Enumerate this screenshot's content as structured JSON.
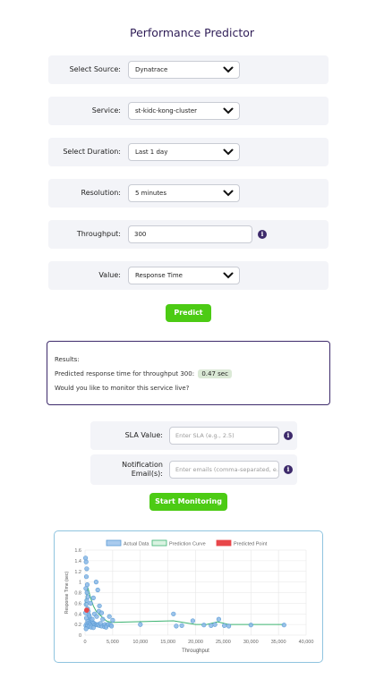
{
  "page": {
    "title": "Performance Predictor"
  },
  "form": {
    "source": {
      "label": "Select Source:",
      "value": "Dynatrace"
    },
    "service": {
      "label": "Service:",
      "value": "st-kidc-kong-cluster"
    },
    "duration": {
      "label": "Select Duration:",
      "value": "Last 1 day"
    },
    "resolution": {
      "label": "Resolution:",
      "value": "5 minutes"
    },
    "throughput": {
      "label": "Throughput:",
      "value": "300"
    },
    "value": {
      "label": "Value:",
      "value": "Response Time"
    },
    "predict_label": "Predict"
  },
  "results": {
    "heading": "Results:",
    "prediction_text": "Predicted response time for throughput 300:",
    "prediction_value": "0.47 sec",
    "question": "Would you like to monitor this service live?"
  },
  "monitoring": {
    "sla_label": "SLA Value:",
    "sla_placeholder": "Enter SLA (e.g., 2.5)",
    "email_label_1": "Notification",
    "email_label_2": "Email(s):",
    "email_placeholder": "Enter emails (comma-separated, e.g.",
    "start_label": "Start Monitoring"
  },
  "colors": {
    "accent_green": "#4ccb14",
    "brand_purple": "#3d2a6b",
    "actual_data": "#5b9bd5",
    "prediction_curve": "#3cb371",
    "predicted_point": "#e8474a"
  },
  "chart_data": {
    "type": "scatter",
    "xlabel": "Throughput",
    "ylabel": "Response Time (sec)",
    "xlim": [
      0,
      40000
    ],
    "ylim": [
      0,
      1.6
    ],
    "x_ticks": [
      "0",
      "5,000",
      "10,000",
      "15,000",
      "20,000",
      "25,000",
      "30,000",
      "35,000",
      "40,000"
    ],
    "y_ticks": [
      "0",
      "0.2",
      "0.4",
      "0.6",
      "0.8",
      "1",
      "1.2",
      "1.4",
      "1.6"
    ],
    "grid": true,
    "legend_position": "top",
    "legend": [
      "Actual Data",
      "Prediction Curve",
      "Predicted Point"
    ],
    "series": [
      {
        "name": "Actual Data",
        "points": [
          [
            100,
            1.45
          ],
          [
            200,
            1.38
          ],
          [
            300,
            1.25
          ],
          [
            250,
            1.1
          ],
          [
            400,
            0.95
          ],
          [
            150,
            0.88
          ],
          [
            350,
            0.8
          ],
          [
            500,
            0.72
          ],
          [
            300,
            0.65
          ],
          [
            200,
            0.58
          ],
          [
            450,
            0.5
          ],
          [
            600,
            0.45
          ],
          [
            100,
            0.42
          ],
          [
            700,
            0.38
          ],
          [
            800,
            0.35
          ],
          [
            250,
            0.32
          ],
          [
            900,
            0.3
          ],
          [
            1000,
            0.28
          ],
          [
            500,
            0.26
          ],
          [
            1200,
            0.25
          ],
          [
            1400,
            0.24
          ],
          [
            600,
            0.22
          ],
          [
            1600,
            0.22
          ],
          [
            300,
            0.21
          ],
          [
            1800,
            0.2
          ],
          [
            2000,
            0.2
          ],
          [
            800,
            0.19
          ],
          [
            2200,
            0.19
          ],
          [
            2400,
            0.2
          ],
          [
            2600,
            0.18
          ],
          [
            150,
            0.18
          ],
          [
            400,
            0.17
          ],
          [
            700,
            0.16
          ],
          [
            1100,
            0.15
          ],
          [
            1500,
            0.14
          ],
          [
            200,
            0.12
          ],
          [
            3000,
            0.17
          ],
          [
            3500,
            0.16
          ],
          [
            2800,
            0.22
          ],
          [
            1300,
            0.3
          ],
          [
            1700,
            0.4
          ],
          [
            2100,
            0.35
          ],
          [
            2500,
            0.45
          ],
          [
            3200,
            0.3
          ],
          [
            3600,
            0.2
          ],
          [
            3900,
            0.18
          ],
          [
            4200,
            0.2
          ],
          [
            4600,
            0.19
          ],
          [
            5000,
            0.28
          ],
          [
            4400,
            0.35
          ],
          [
            2300,
            0.85
          ],
          [
            2000,
            1.0
          ],
          [
            2600,
            0.55
          ],
          [
            3000,
            0.42
          ],
          [
            1000,
            0.6
          ],
          [
            1500,
            0.7
          ],
          [
            3800,
            0.15
          ],
          [
            4800,
            0.17
          ],
          [
            10000,
            0.2
          ],
          [
            16000,
            0.4
          ],
          [
            16500,
            0.17
          ],
          [
            17500,
            0.18
          ],
          [
            19500,
            0.27
          ],
          [
            21500,
            0.19
          ],
          [
            22800,
            0.18
          ],
          [
            23500,
            0.2
          ],
          [
            24200,
            0.3
          ],
          [
            25200,
            0.18
          ],
          [
            26000,
            0.17
          ],
          [
            30000,
            0.19
          ],
          [
            36000,
            0.19
          ]
        ]
      },
      {
        "name": "Prediction Curve",
        "points": [
          [
            0,
            0.55
          ],
          [
            500,
            0.9
          ],
          [
            1000,
            0.7
          ],
          [
            1500,
            0.55
          ],
          [
            2000,
            0.45
          ],
          [
            2500,
            0.4
          ],
          [
            3000,
            0.35
          ],
          [
            3500,
            0.3
          ],
          [
            4000,
            0.26
          ],
          [
            5000,
            0.24
          ],
          [
            8000,
            0.25
          ],
          [
            12000,
            0.26
          ],
          [
            16000,
            0.27
          ],
          [
            20000,
            0.2
          ],
          [
            22000,
            0.2
          ],
          [
            24000,
            0.25
          ],
          [
            26000,
            0.2
          ],
          [
            30000,
            0.2
          ],
          [
            36000,
            0.2
          ]
        ]
      },
      {
        "name": "Predicted Point",
        "points": [
          [
            300,
            0.47
          ]
        ]
      }
    ]
  }
}
